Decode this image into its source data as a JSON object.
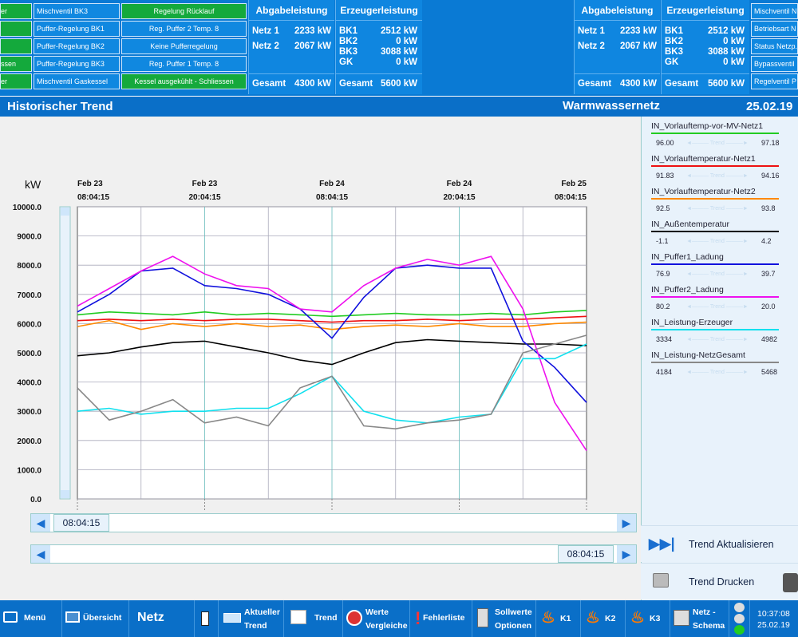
{
  "status_buttons": [
    {
      "name": "Mischventil BK3",
      "state": "Regelung Rücklauf",
      "state_color": "green",
      "prefix": "er"
    },
    {
      "name": "Puffer-Regelung BK1",
      "state": "Reg. Puffer 2 Temp. 8",
      "state_color": "blue",
      "prefix": ""
    },
    {
      "name": "Puffer-Regelung BK2",
      "state": "Keine Pufferregelung",
      "state_color": "blue",
      "prefix": ""
    },
    {
      "name": "Puffer-Regelung BK3",
      "state": "Reg. Puffer 1 Temp. 8",
      "state_color": "blue",
      "prefix": "ssen"
    },
    {
      "name": "Mischventil Gaskessel",
      "state": "Kessel ausgekühlt - Schliessen",
      "state_color": "green",
      "prefix": "er"
    }
  ],
  "right_status": [
    "Mischventil N",
    "Betriebsart N",
    "Status Netzp.",
    "Bypassventil",
    "Regelventil P"
  ],
  "abgabe": {
    "title": "Abgabeleistung",
    "rows": [
      {
        "k": "Netz 1",
        "v": "2233 kW"
      },
      {
        "k": "Netz 2",
        "v": "2067 kW"
      }
    ],
    "total_k": "Gesamt",
    "total_v": "4300 kW"
  },
  "erzeuger": {
    "title": "Erzeugerleistung",
    "rows": [
      {
        "k": "BK1",
        "v": "2512 kW"
      },
      {
        "k": "BK2",
        "v": "0 kW"
      },
      {
        "k": "BK3",
        "v": "3088 kW"
      },
      {
        "k": "GK",
        "v": "0 kW"
      }
    ],
    "total_k": "Gesamt",
    "total_v": "5600 kW"
  },
  "titlebar": {
    "left": "Historischer Trend",
    "center": "Warmwassernetz",
    "date": "25.02.19"
  },
  "chart_data": {
    "type": "line",
    "ylabel": "kW",
    "ylim": [
      0,
      10000
    ],
    "yticks": [
      "10000.0",
      "9000.0",
      "8000.0",
      "7000.0",
      "6000.0",
      "5000.0",
      "4000.0",
      "3000.0",
      "2000.0",
      "1000.0",
      "0.0"
    ],
    "xticks": [
      {
        "d": "Feb 23",
        "t": "08:04:15"
      },
      {
        "d": "Feb 23",
        "t": "20:04:15"
      },
      {
        "d": "Feb 24",
        "t": "08:04:15"
      },
      {
        "d": "Feb 24",
        "t": "20:04:15"
      },
      {
        "d": "Feb 25",
        "t": "08:04:15"
      }
    ],
    "x_hours": [
      0,
      3,
      6,
      9,
      12,
      15,
      18,
      21,
      24,
      27,
      30,
      33,
      36,
      39,
      42,
      45,
      48
    ],
    "series": [
      {
        "name": "IN_Vorlauftemp-vor-MV-Netz1",
        "color": "#22cc22",
        "values": [
          6300,
          6400,
          6350,
          6300,
          6400,
          6300,
          6350,
          6300,
          6250,
          6300,
          6350,
          6300,
          6300,
          6350,
          6300,
          6400,
          6450
        ]
      },
      {
        "name": "IN_Vorlauftemperatur-Netz1",
        "color": "#ee1111",
        "values": [
          6100,
          6150,
          6100,
          6150,
          6100,
          6150,
          6150,
          6100,
          6050,
          6100,
          6100,
          6150,
          6100,
          6150,
          6150,
          6200,
          6250
        ]
      },
      {
        "name": "IN_Vorlauftemperatur-Netz2",
        "color": "#ff8800",
        "values": [
          5900,
          6100,
          5800,
          6000,
          5900,
          6000,
          5900,
          5950,
          5800,
          5900,
          5950,
          5900,
          6000,
          5900,
          5900,
          6000,
          6050
        ]
      },
      {
        "name": "IN_Außentemperatur",
        "color": "#000000",
        "values": [
          4900,
          5000,
          5200,
          5350,
          5400,
          5200,
          5000,
          4750,
          4600,
          5000,
          5350,
          5450,
          5400,
          5350,
          5300,
          5300,
          5250
        ]
      },
      {
        "name": "IN_Puffer1_Ladung",
        "color": "#1111dd",
        "values": [
          6400,
          7000,
          7800,
          7900,
          7300,
          7200,
          7000,
          6500,
          5500,
          6900,
          7900,
          8000,
          7900,
          7900,
          5400,
          4500,
          3300
        ]
      },
      {
        "name": "IN_Puffer2_Ladung",
        "color": "#ee11ee",
        "values": [
          6600,
          7200,
          7800,
          8300,
          7700,
          7300,
          7200,
          6500,
          6400,
          7300,
          7900,
          8200,
          8000,
          8300,
          6500,
          3300,
          1650
        ]
      },
      {
        "name": "IN_Leistung-Erzeuger",
        "color": "#11e0ee",
        "values": [
          3000,
          3100,
          2900,
          3000,
          3000,
          3100,
          3100,
          3600,
          4200,
          3000,
          2700,
          2600,
          2800,
          2900,
          4800,
          4800,
          5300
        ]
      },
      {
        "name": "IN_Leistung-NetzGesamt",
        "color": "#888888",
        "values": [
          3800,
          2700,
          3000,
          3400,
          2600,
          2800,
          2500,
          3800,
          4200,
          2500,
          2400,
          2600,
          2700,
          2900,
          5000,
          5300,
          5600
        ]
      }
    ]
  },
  "legend_items": [
    {
      "name": "IN_Vorlauftemp-vor-MV-Netz1",
      "color": "#22cc22",
      "min": "96.00",
      "max": "97.18"
    },
    {
      "name": "IN_Vorlauftemperatur-Netz1",
      "color": "#ee1111",
      "min": "91.83",
      "max": "94.16"
    },
    {
      "name": "IN_Vorlauftemperatur-Netz2",
      "color": "#ff8800",
      "min": "92.5",
      "max": "93.8"
    },
    {
      "name": "IN_Außentemperatur",
      "color": "#000000",
      "min": "-1.1",
      "max": "4.2"
    },
    {
      "name": "IN_Puffer1_Ladung",
      "color": "#1111dd",
      "min": "76.9",
      "max": "39.7"
    },
    {
      "name": "IN_Puffer2_Ladung",
      "color": "#ee11ee",
      "min": "80.2",
      "max": "20.0"
    },
    {
      "name": "IN_Leistung-Erzeuger",
      "color": "#11e0ee",
      "min": "3334",
      "max": "4982"
    },
    {
      "name": "IN_Leistung-NetzGesamt",
      "color": "#888888",
      "min": "4184",
      "max": "5468"
    }
  ],
  "legend_mid_text": "Trend",
  "scroll1_time": "08:04:15",
  "scroll2_time": "08:04:15",
  "side_buttons": {
    "update": "Trend Aktualisieren",
    "print": "Trend Drucken"
  },
  "bottom_nav": {
    "menu": "Menü",
    "overview": "Übersicht",
    "section": "Netz",
    "current_trend_1": "Aktueller",
    "current_trend_2": "Trend",
    "trend": "Trend",
    "compare_1": "Werte",
    "compare_2": "Vergleiche",
    "errors": "Fehlerliste",
    "setpoints_1": "Sollwerte",
    "setpoints_2": "Optionen",
    "k1": "K1",
    "k2": "K2",
    "k3": "K3",
    "schema_1": "Netz -",
    "schema_2": "Schema",
    "time": "10:37:08",
    "date": "25.02.19"
  }
}
